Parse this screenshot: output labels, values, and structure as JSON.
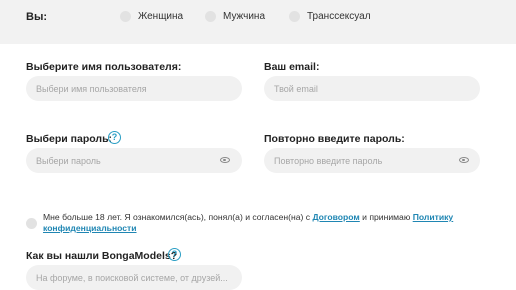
{
  "gender": {
    "label": "Вы:",
    "options": [
      "Женщина",
      "Мужчина",
      "Транссексуал"
    ]
  },
  "username": {
    "label": "Выберите имя пользователя:",
    "placeholder": "Выбери имя пользователя"
  },
  "email": {
    "label": "Ваш email:",
    "placeholder": "Твой email"
  },
  "password": {
    "label": "Выбери пароль:",
    "help_icon": "?",
    "placeholder": "Выбери пароль"
  },
  "password_repeat": {
    "label": "Повторно введите пароль:",
    "placeholder": "Повторно введите пароль"
  },
  "agreement": {
    "text_before": "Мне больше 18 лет. Я ознакомился(ась), понял(а) и согласен(на) с ",
    "terms_link": "Договором",
    "text_middle": " и принимаю ",
    "privacy_link": "Политику конфиденциальности"
  },
  "referral": {
    "label": "Как вы нашли BongaModels?",
    "help_icon": "?",
    "placeholder": "На форуме, в поисковой системе, от друзей..."
  },
  "icons": {
    "password_visibility": "eye-icon",
    "help": "question-circle-icon"
  },
  "colors": {
    "accent": "#2a9ec4",
    "link": "#1f86b3",
    "input_bg": "#f1f1f1",
    "band_bg": "#f2f2f2"
  }
}
